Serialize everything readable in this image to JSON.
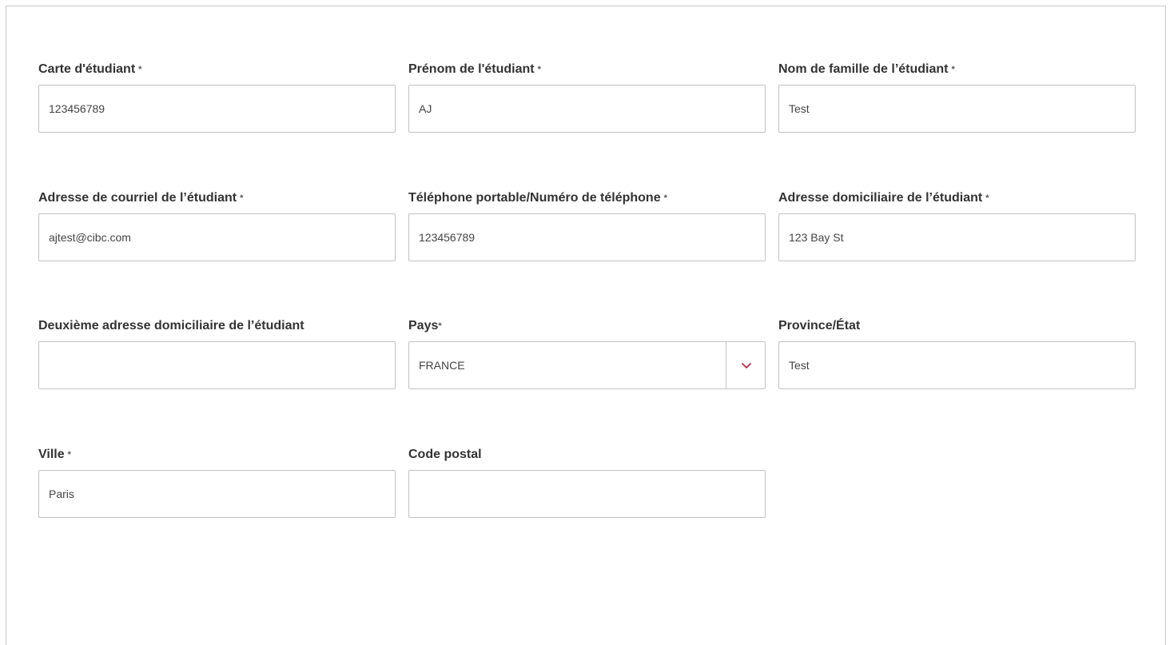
{
  "form": {
    "student_id": {
      "label": "Carte d'étudiant",
      "required_mark": "*",
      "value": "123456789",
      "placeholder": ""
    },
    "first_name": {
      "label": "Prénom de l'étudiant",
      "required_mark": "*",
      "value": "AJ",
      "placeholder": ""
    },
    "last_name": {
      "label": "Nom de famille de l’étudiant",
      "required_mark": "*",
      "value": "Test",
      "placeholder": ""
    },
    "email": {
      "label": "Adresse de courriel de l’étudiant",
      "required_mark": "*",
      "value": "ajtest@cibc.com",
      "placeholder": ""
    },
    "phone": {
      "label": "Téléphone portable/Numéro de téléphone",
      "required_mark": "*",
      "value": "123456789",
      "placeholder": ""
    },
    "home_address": {
      "label": "Adresse domiciliaire de l’étudiant",
      "required_mark": "*",
      "value": "123 Bay St",
      "placeholder": ""
    },
    "home_address_2": {
      "label": "Deuxième adresse domiciliaire de l’étudiant",
      "value": "",
      "placeholder": ""
    },
    "country": {
      "label": "Pays",
      "required_mark": "*",
      "selected": "FRANCE",
      "chevron_icon": "chevron-down-icon",
      "chevron_color": "#c41f3e"
    },
    "province": {
      "label": "Province/État",
      "value": "Test",
      "placeholder": ""
    },
    "city": {
      "label": "Ville",
      "required_mark": "*",
      "value": "Paris",
      "placeholder": ""
    },
    "postal_code": {
      "label": "Code postal",
      "value": "",
      "placeholder": ""
    }
  }
}
